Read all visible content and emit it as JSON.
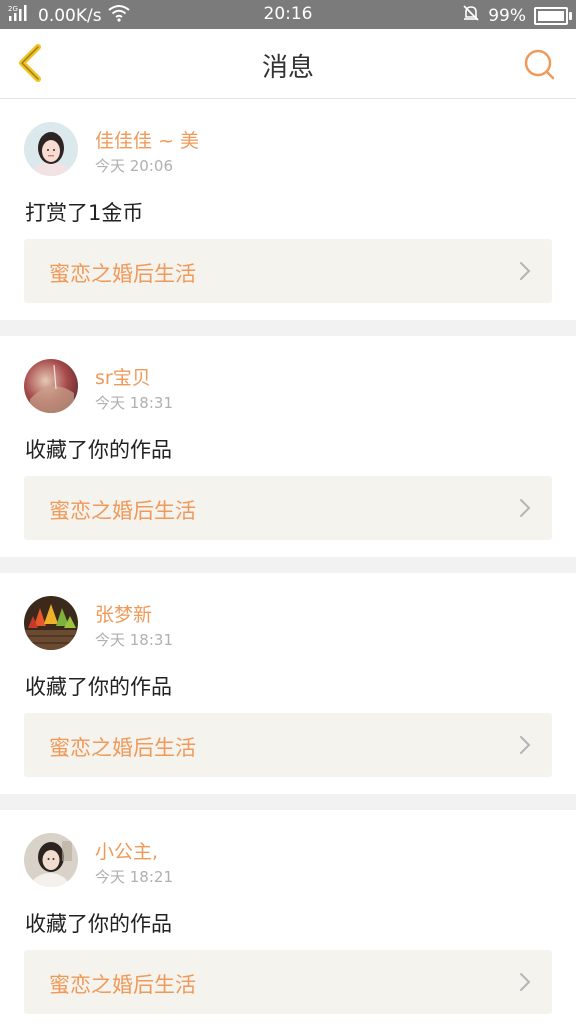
{
  "status_bar": {
    "network_type": "2G",
    "speed": "0.00K/s",
    "time": "20:16",
    "battery": "99%",
    "icons": [
      "signal-icon",
      "wifi-icon",
      "silent-bell-icon",
      "battery-icon"
    ]
  },
  "header": {
    "title": "消息",
    "back_icon": "chevron-left-icon",
    "search_icon": "search-icon"
  },
  "colors": {
    "accent": "#f09a5a",
    "back_icon": "#f4c21c",
    "card_bg": "#ffffff",
    "book_bg": "#f4f3ee",
    "divider": "#f2f2f2"
  },
  "messages": [
    {
      "user": "佳佳佳 ~ 美",
      "time": "今天 20:06",
      "action": "打赏了1金币",
      "book": "蜜恋之婚后生活"
    },
    {
      "user": "sr宝贝",
      "time": "今天 18:31",
      "action": "收藏了你的作品",
      "book": "蜜恋之婚后生活"
    },
    {
      "user": "张梦新",
      "time": "今天 18:31",
      "action": "收藏了你的作品",
      "book": "蜜恋之婚后生活"
    },
    {
      "user": "小公主,",
      "time": "今天 18:21",
      "action": "收藏了你的作品",
      "book": "蜜恋之婚后生活"
    }
  ]
}
